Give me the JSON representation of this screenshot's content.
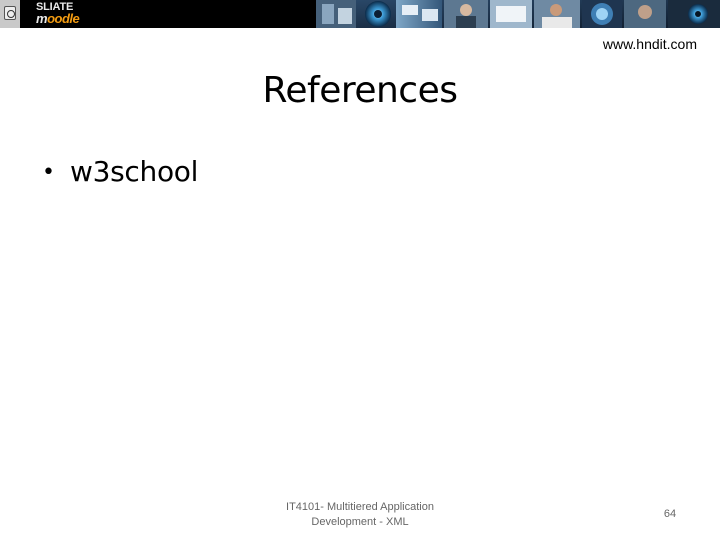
{
  "header": {
    "logo": {
      "line1": "SLIATE",
      "line2_prefix": "m",
      "line2_rest": "oodle"
    },
    "banner_colors": {
      "background": "#000000",
      "accent": "#f39c12"
    }
  },
  "slide": {
    "url": "www.hndit.com",
    "title": "References",
    "bullets": [
      {
        "text": "w3school"
      }
    ],
    "footer": {
      "line1": "IT4101- Multitiered Application",
      "line2": "Development - XML"
    },
    "page_number": "64"
  }
}
